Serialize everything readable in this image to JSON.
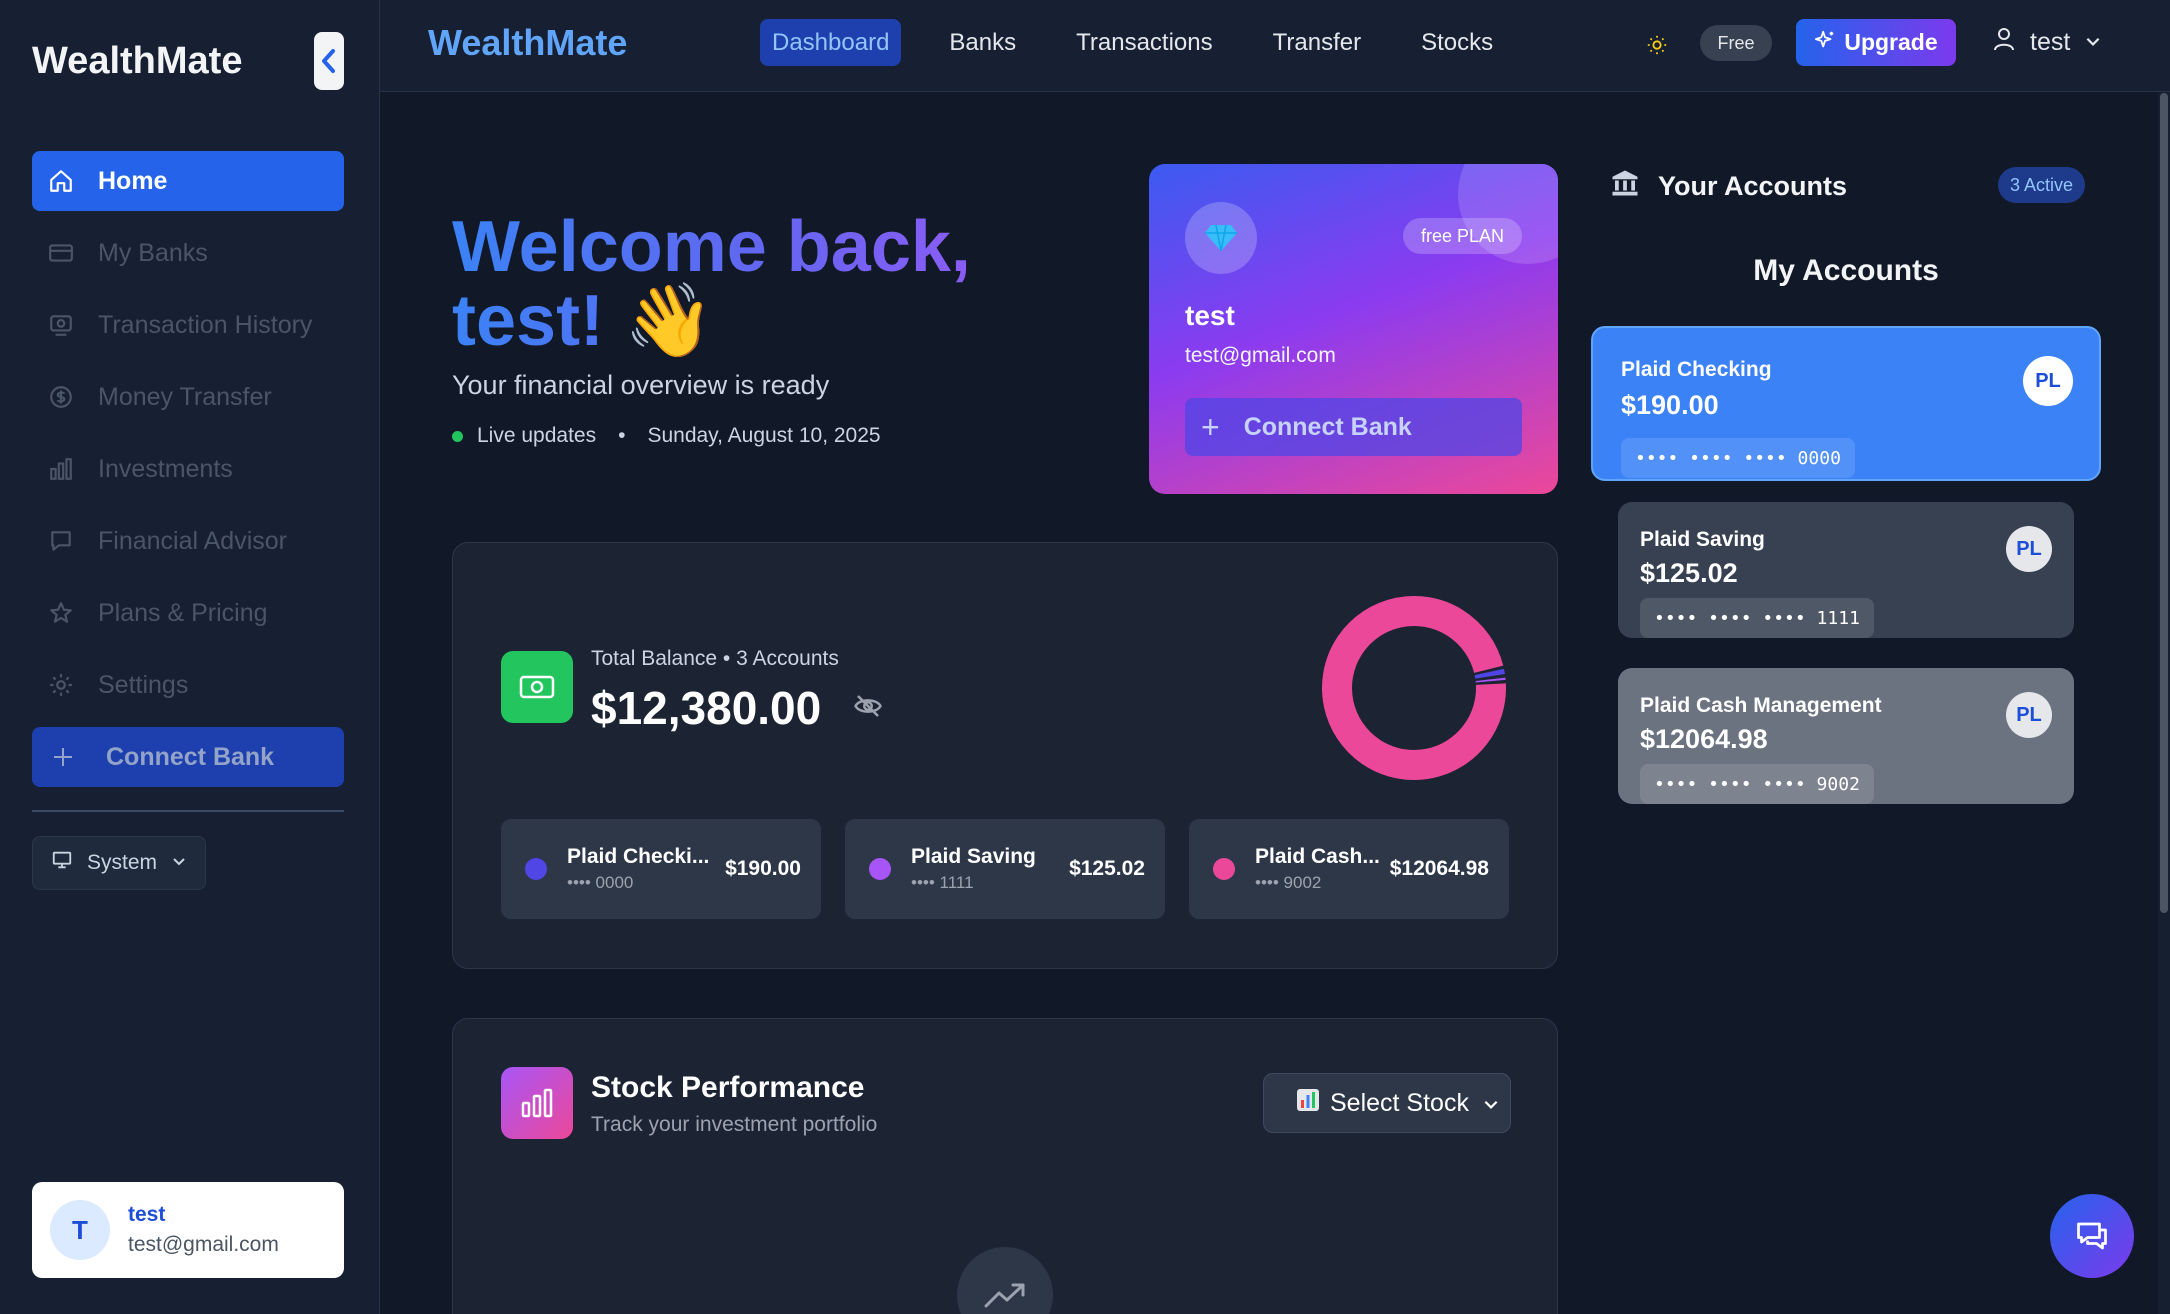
{
  "sidebar": {
    "brand": "WealthMate",
    "items": [
      {
        "label": "Home",
        "icon": "home-icon"
      },
      {
        "label": "My Banks",
        "icon": "bank-card-icon"
      },
      {
        "label": "Transaction History",
        "icon": "receipt-icon"
      },
      {
        "label": "Money Transfer",
        "icon": "dollar-circle-icon"
      },
      {
        "label": "Investments",
        "icon": "bar-chart-icon"
      },
      {
        "label": "Financial Advisor",
        "icon": "chat-icon"
      },
      {
        "label": "Plans & Pricing",
        "icon": "star-icon"
      },
      {
        "label": "Settings",
        "icon": "gear-icon"
      }
    ],
    "connect_label": "Connect Bank",
    "theme_label": "System",
    "user": {
      "initial": "T",
      "name": "test",
      "email": "test@gmail.com"
    }
  },
  "topbar": {
    "brand": "WealthMate",
    "nav": [
      "Dashboard",
      "Banks",
      "Transactions",
      "Transfer",
      "Stocks"
    ],
    "active_nav": "Dashboard",
    "plan_badge": "Free",
    "upgrade_label": "Upgrade",
    "user_name": "test"
  },
  "welcome": {
    "line1": "Welcome back,",
    "line2": "test!",
    "wave": "👋",
    "subtitle": "Your financial overview is ready",
    "live_label": "Live updates",
    "date": "Sunday, August 10, 2025"
  },
  "profile_card": {
    "plan": "free PLAN",
    "name": "test",
    "email": "test@gmail.com",
    "connect_label": "Connect Bank"
  },
  "balance": {
    "label": "Total Balance • 3 Accounts",
    "amount": "$12,380.00",
    "accounts": [
      {
        "name": "Plaid Checki...",
        "mask": "•••• 0000",
        "amount": "$190.00",
        "color": "#4f46e5",
        "value": 190.0
      },
      {
        "name": "Plaid Saving",
        "mask": "•••• 1111",
        "amount": "$125.02",
        "color": "#a855f7",
        "value": 125.02
      },
      {
        "name": "Plaid Cash...",
        "mask": "•••• 9002",
        "amount": "$12064.98",
        "color": "#ec4899",
        "value": 12064.98
      }
    ]
  },
  "stock": {
    "title": "Stock Performance",
    "subtitle": "Track your investment portfolio",
    "select_label": "Select Stock"
  },
  "accounts_panel": {
    "header": "Your Accounts",
    "badge": "3 Active",
    "title": "My Accounts",
    "cards": [
      {
        "name": "Plaid Checking",
        "amount": "$190.00",
        "mask": "•••• •••• •••• 0000",
        "initials": "PL"
      },
      {
        "name": "Plaid Saving",
        "amount": "$125.02",
        "mask": "•••• •••• •••• 1111",
        "initials": "PL"
      },
      {
        "name": "Plaid Cash Management",
        "amount": "$12064.98",
        "mask": "•••• •••• •••• 9002",
        "initials": "PL"
      }
    ]
  },
  "colors": {
    "accent": "#2563eb",
    "brand_text": "#60a5fa",
    "live_dot": "#22c55e"
  }
}
